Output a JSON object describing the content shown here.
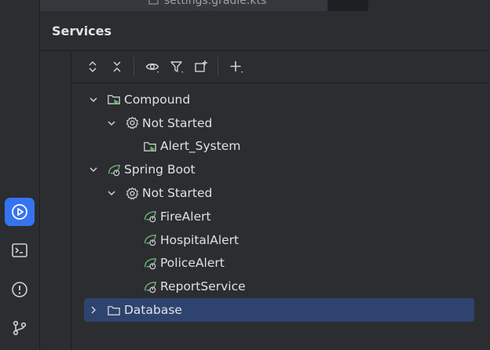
{
  "top_fragment": {
    "file_name": "settings.gradle.kts"
  },
  "services": {
    "title": "Services",
    "toolbar": {
      "expand_all": "expand-all",
      "collapse_all": "collapse-all",
      "view_options": "view-options",
      "filter": "filter",
      "new_tab": "open-in-new-tab",
      "add": "add"
    },
    "tree": [
      {
        "label": "Compound",
        "level": 0,
        "expanded": true,
        "icon": "compound-run-icon"
      },
      {
        "label": "Not Started",
        "level": 1,
        "expanded": true,
        "icon": "gear-icon"
      },
      {
        "label": "Alert_System",
        "level": 2,
        "icon": "compound-run-icon"
      },
      {
        "label": "Spring Boot",
        "level": 0,
        "expanded": true,
        "icon": "spring-boot-icon"
      },
      {
        "label": "Not Started",
        "level": 1,
        "expanded": true,
        "icon": "gear-icon"
      },
      {
        "label": "FireAlert",
        "level": 2,
        "icon": "spring-boot-icon"
      },
      {
        "label": "HospitalAlert",
        "level": 2,
        "icon": "spring-boot-icon"
      },
      {
        "label": "PoliceAlert",
        "level": 2,
        "icon": "spring-boot-icon"
      },
      {
        "label": "ReportService",
        "level": 2,
        "icon": "spring-boot-icon"
      },
      {
        "label": "Database",
        "level": 0,
        "expanded": false,
        "selected": true,
        "icon": "folder-icon"
      }
    ]
  },
  "left_strip": [
    "services-icon",
    "terminal-icon",
    "problems-icon",
    "git-icon"
  ],
  "colors": {
    "accent": "#3574f0",
    "selection": "#2e436e",
    "spring_green": "#6aab73"
  }
}
